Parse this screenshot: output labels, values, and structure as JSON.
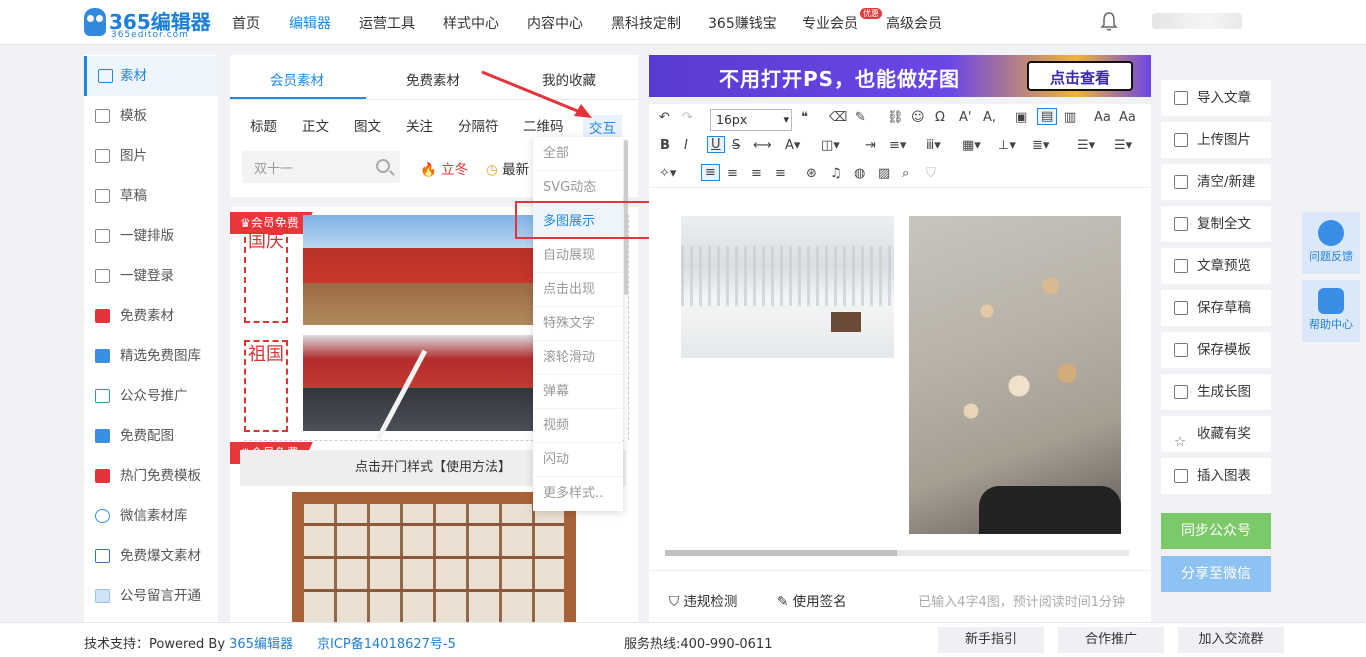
{
  "logo": {
    "main": "365编辑器",
    "sub": "365editor.com"
  },
  "nav": [
    "首页",
    "编辑器",
    "运营工具",
    "样式中心",
    "内容中心",
    "黑科技定制",
    "365赚钱宝",
    "专业会员",
    "高级会员"
  ],
  "nav_hot_badge": "优惠",
  "left_nav": [
    "素材",
    "模板",
    "图片",
    "草稿",
    "一键排版",
    "一键登录",
    "免费素材",
    "精选免费图库",
    "公众号推广",
    "免费配图",
    "热门免费模板",
    "微信素材库",
    "免费爆文素材",
    "公号留言开通"
  ],
  "material_tabs": [
    "会员素材",
    "免费素材",
    "我的收藏"
  ],
  "categories": [
    "标题",
    "正文",
    "图文",
    "关注",
    "分隔符",
    "二维码",
    "交互"
  ],
  "search_placeholder": "双十一",
  "chips": [
    "立冬",
    "最新"
  ],
  "badge": "会员免费",
  "card_texts": [
    "国庆",
    "祖国"
  ],
  "open_door_label": "点击开门样式【使用方法】",
  "dropdown": [
    "全部",
    "SVG动态",
    "多图展示",
    "自动展现",
    "点击出现",
    "特殊文字",
    "滚轮滑动",
    "弹幕",
    "视频",
    "闪动",
    "更多样式.."
  ],
  "banner": {
    "text": "不用打开PS，也能做好图",
    "button": "点击查看"
  },
  "toolbar": {
    "font_size": "16px"
  },
  "editor_footer": {
    "check": "违规检测",
    "signature": "使用签名",
    "stats": "已输入4字4图，预计阅读时间1分钟"
  },
  "right_actions": [
    "导入文章",
    "上传图片",
    "清空/新建",
    "复制全文",
    "文章预览",
    "保存草稿",
    "保存模板",
    "生成长图",
    "收藏有奖",
    "插入图表"
  ],
  "sync_button": "同步公众号",
  "share_button": "分享至微信",
  "float_help": [
    "问题反馈",
    "帮助中心"
  ],
  "footer": {
    "support_prefix": "技术支持：Powered By ",
    "support_link": "365编辑器",
    "icp": "京ICP备14018627号-5",
    "hotline": "服务热线:400-990-0611",
    "buttons": [
      "新手指引",
      "合作推广",
      "加入交流群"
    ]
  },
  "colors": {
    "accent": "#1e88e5",
    "red": "#e2343a",
    "sync_green": "#7cc96a",
    "share_blue": "#8ec2f3"
  }
}
